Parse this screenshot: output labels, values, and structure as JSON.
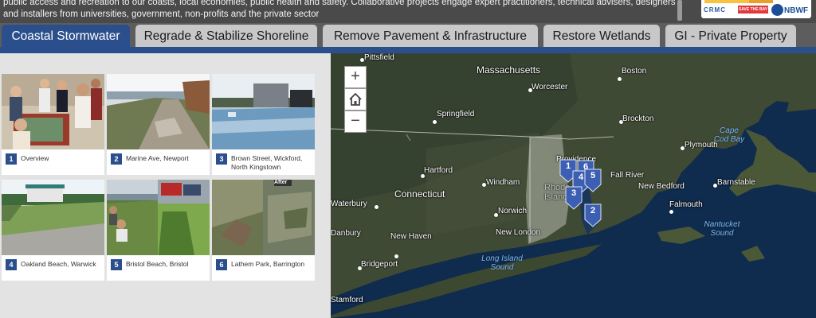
{
  "header": {
    "intro_lines": [
      "public access and recreation to our coasts, local economies, public health and safety. Collaborative projects engage expert practitioners, technical advisers, designers",
      "and installers from universities, government, non-profits and the private sector"
    ],
    "logos": [
      "CRMC",
      "SAVE THE BAY",
      "NBWF"
    ]
  },
  "tabs": [
    {
      "label": "Coastal Stormwater",
      "active": true
    },
    {
      "label": "Regrade & Stabilize Shoreline",
      "active": false
    },
    {
      "label": "Remove Pavement & Infrastructure",
      "active": false
    },
    {
      "label": "Restore Wetlands",
      "active": false
    },
    {
      "label": "GI - Private Property",
      "active": false
    }
  ],
  "gallery": [
    {
      "num": "1",
      "caption": "Overview"
    },
    {
      "num": "2",
      "caption": "Marine Ave, Newport"
    },
    {
      "num": "3",
      "caption": "Brown Street, Wickford, North Kingstown"
    },
    {
      "num": "4",
      "caption": "Oakland Beach, Warwick"
    },
    {
      "num": "5",
      "caption": "Bristol Beach, Bristol"
    },
    {
      "num": "6",
      "caption": "Lathem Park, Barrington"
    }
  ],
  "photo_labels": {
    "after": "After"
  },
  "map": {
    "zoom_in": "+",
    "home_icon": "home-icon",
    "zoom_out": "−",
    "places": {
      "pittsfield": "Pittsfield",
      "massachusetts": "Massachusetts",
      "worcester": "Worcester",
      "boston": "Boston",
      "springfield": "Springfield",
      "brockton": "Brockton",
      "providence": "Providence",
      "plymouth": "Plymouth",
      "hartford": "Hartford",
      "connecticut": "Connecticut",
      "windham": "Windham",
      "fall_river": "Fall River",
      "new_bedford": "New Bedford",
      "barnstable": "Barnstable",
      "waterbury": "Waterbury",
      "norwich": "Norwich",
      "falmouth": "Falmouth",
      "danbury": "Danbury",
      "new_haven": "New Haven",
      "new_london": "New London",
      "bridgeport": "Bridgeport",
      "stamford": "Stamford",
      "rhode_island": "Rhode Island"
    },
    "water": {
      "cape_cod_bay": "Cape Cod Bay",
      "long_island_sound": "Long Island Sound",
      "nantucket_sound": "Nantucket Sound"
    },
    "pins": [
      "1",
      "6",
      "4",
      "5",
      "3",
      "2"
    ]
  },
  "colors": {
    "accent": "#2b4f8c",
    "tab_inactive": "#c8c8c8",
    "header_bg": "#4a4a4a",
    "ocean": "#0f2b4d"
  }
}
